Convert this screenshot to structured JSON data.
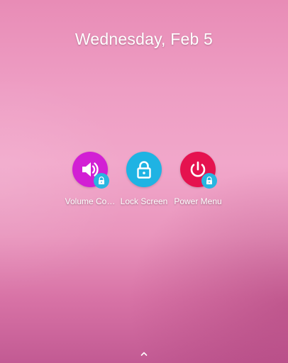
{
  "lockscreen": {
    "date": "Wednesday, Feb 5"
  },
  "shortcuts": [
    {
      "label": "Volume Co…",
      "icon": "speaker-icon",
      "color": "#d21fd4",
      "locked": true
    },
    {
      "label": "Lock Screen",
      "icon": "lock-icon",
      "color": "#1fb3e3",
      "locked": false
    },
    {
      "label": "Power Menu",
      "icon": "power-icon",
      "color": "#e5124f",
      "locked": true
    }
  ],
  "badge_color": "#29b6e0",
  "bottom": {
    "icon": "chevron-up-icon"
  }
}
